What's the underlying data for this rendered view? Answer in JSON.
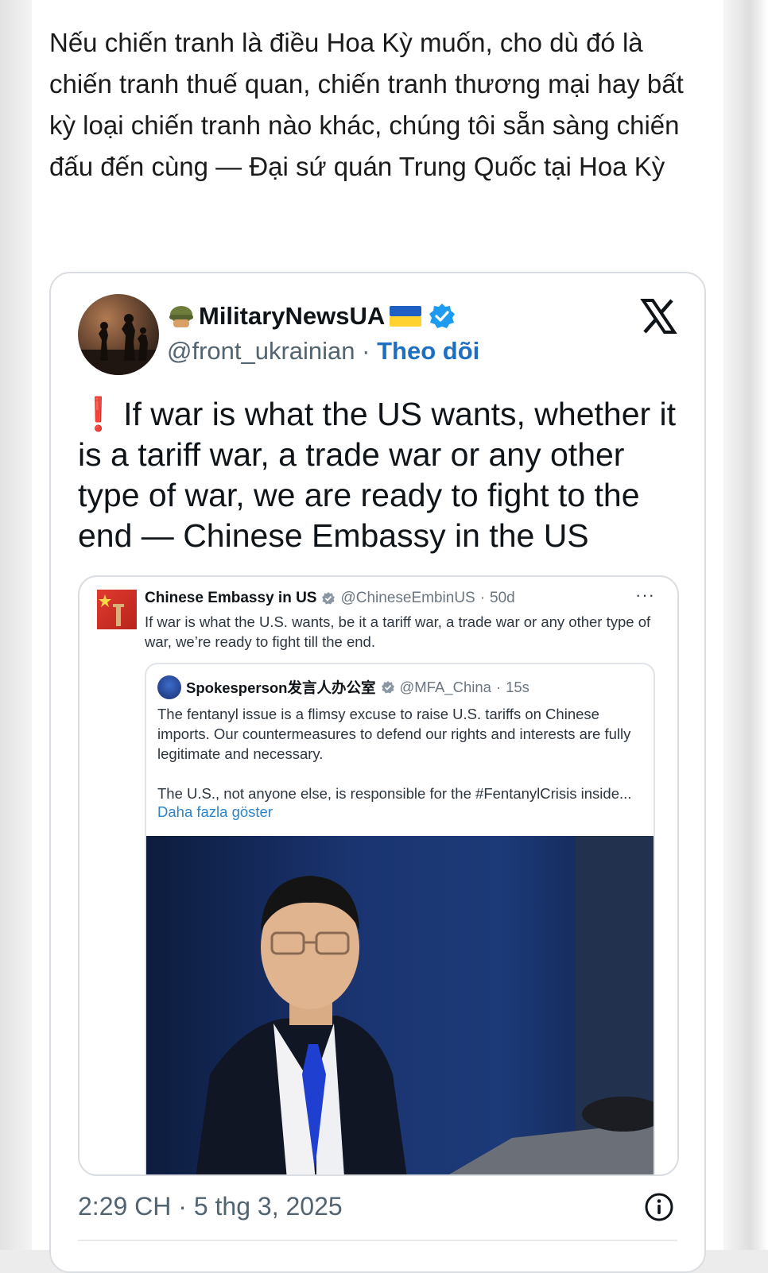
{
  "caption": "Nếu chiến tranh là điều Hoa Kỳ muốn, cho dù đó là chiến tranh thuế quan, chiến tranh thương mại hay bất kỳ loại chiến tranh nào khác, chúng tôi sẵn sàng chiến đấu đến cùng — Đại sứ quán Trung Quốc tại Hoa Kỳ",
  "embed": {
    "author_name": "MilitaryNewsUA",
    "author_handle": "@front_ukrainian",
    "separator": " · ",
    "follow_label": "Theo dõi",
    "platform_icon": "x-logo-icon",
    "alert_icon": "❗",
    "tweet_text": "If war is what the US wants, whether it is a tariff war, a trade war or any other type of war, we are ready to fight to the end — Chinese Embassy in the US",
    "timestamp": "2:29 CH · 5 thg 3, 2025",
    "info_icon": "info-icon"
  },
  "screenshot": {
    "author_name": "Chinese Embassy in US",
    "author_handle": "@ChineseEmbinUS",
    "age": "50d",
    "more": "···",
    "text": "If war is what the U.S. wants, be it a tariff war, a trade war or any other type of war, we’re ready to fight till the end.",
    "quoted": {
      "author_name": "Spokesperson发言人办公室",
      "author_handle": "@MFA_China",
      "age": "15s",
      "text1": "The fentanyl issue is a flimsy excuse to raise U.S. tariffs on Chinese imports. Our countermeasures to defend our rights and interests are fully legitimate and necessary.",
      "text2": "The U.S., not anyone else, is responsible for the #FentanylCrisis inside...",
      "more_link": "Daha fazla göster"
    }
  },
  "colors": {
    "text": "#0f1419",
    "muted": "#536471",
    "link": "#1d6fc4",
    "verified": "#1d9bf0",
    "alert": "#d0222c"
  }
}
